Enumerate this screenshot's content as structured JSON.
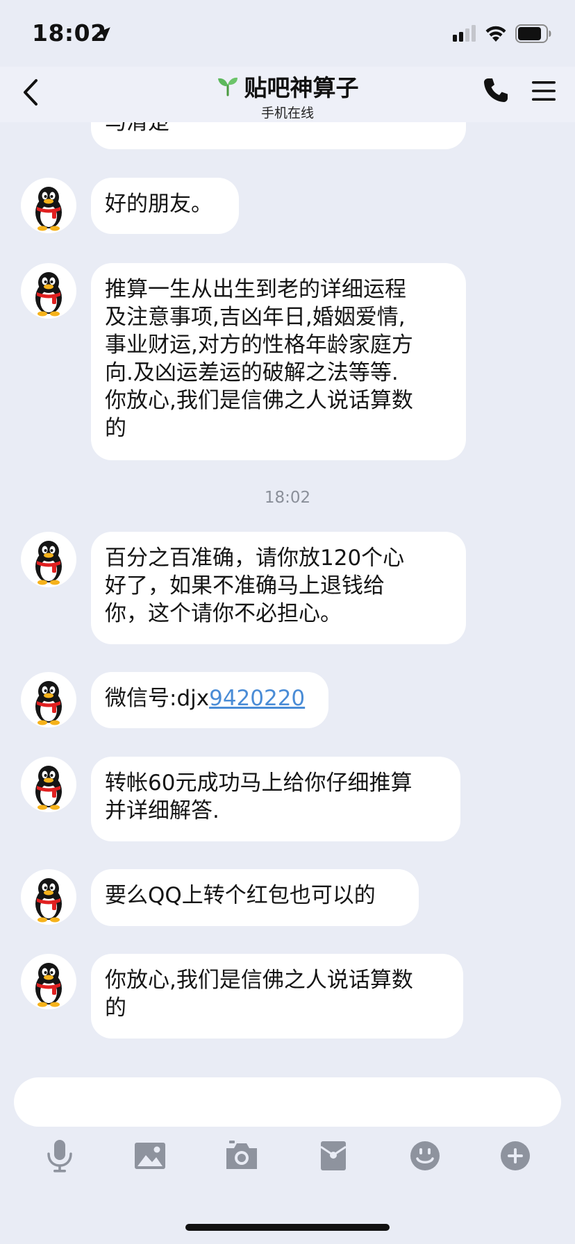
{
  "status_bar": {
    "time": "18:02"
  },
  "header": {
    "title": "贴吧神算子",
    "subtitle": "手机在线"
  },
  "messages": {
    "cut_top": "马清楚",
    "m1": "好的朋友。",
    "m2_lines": [
      "推算一生从出生到老的详细运程",
      "及注意事项,吉凶年日,婚姻爱情,",
      "事业财运,对方的性格年龄家庭方",
      "向.及凶运差运的破解之法等等.",
      "你放心,我们是信佛之人说话算数",
      "的"
    ],
    "timestamp": "18:02",
    "m3_lines": [
      "百分之百准确，请你放120个心",
      "好了，如果不准确马上退钱给",
      "你，这个请你不必担心。"
    ],
    "m4_prefix": "微信号:djx",
    "m4_link": "9420220",
    "m5_lines": [
      "转帐60元成功马上给你仔细推算",
      "并详细解答."
    ],
    "m6": "要么QQ上转个红包也可以的",
    "m7_lines": [
      "你放心,我们是信佛之人说话算数",
      "的"
    ]
  },
  "input": {
    "placeholder": ""
  },
  "toolbar": {
    "icons": [
      "microphone-icon",
      "image-icon",
      "camera-icon",
      "red-packet-icon",
      "emoji-icon",
      "plus-icon"
    ]
  },
  "colors": {
    "background": "#e9ecf5",
    "bubble": "#ffffff",
    "link": "#4a8cd6",
    "icon_gray": "#8e939e",
    "sprout_green": "#5cb85c"
  }
}
